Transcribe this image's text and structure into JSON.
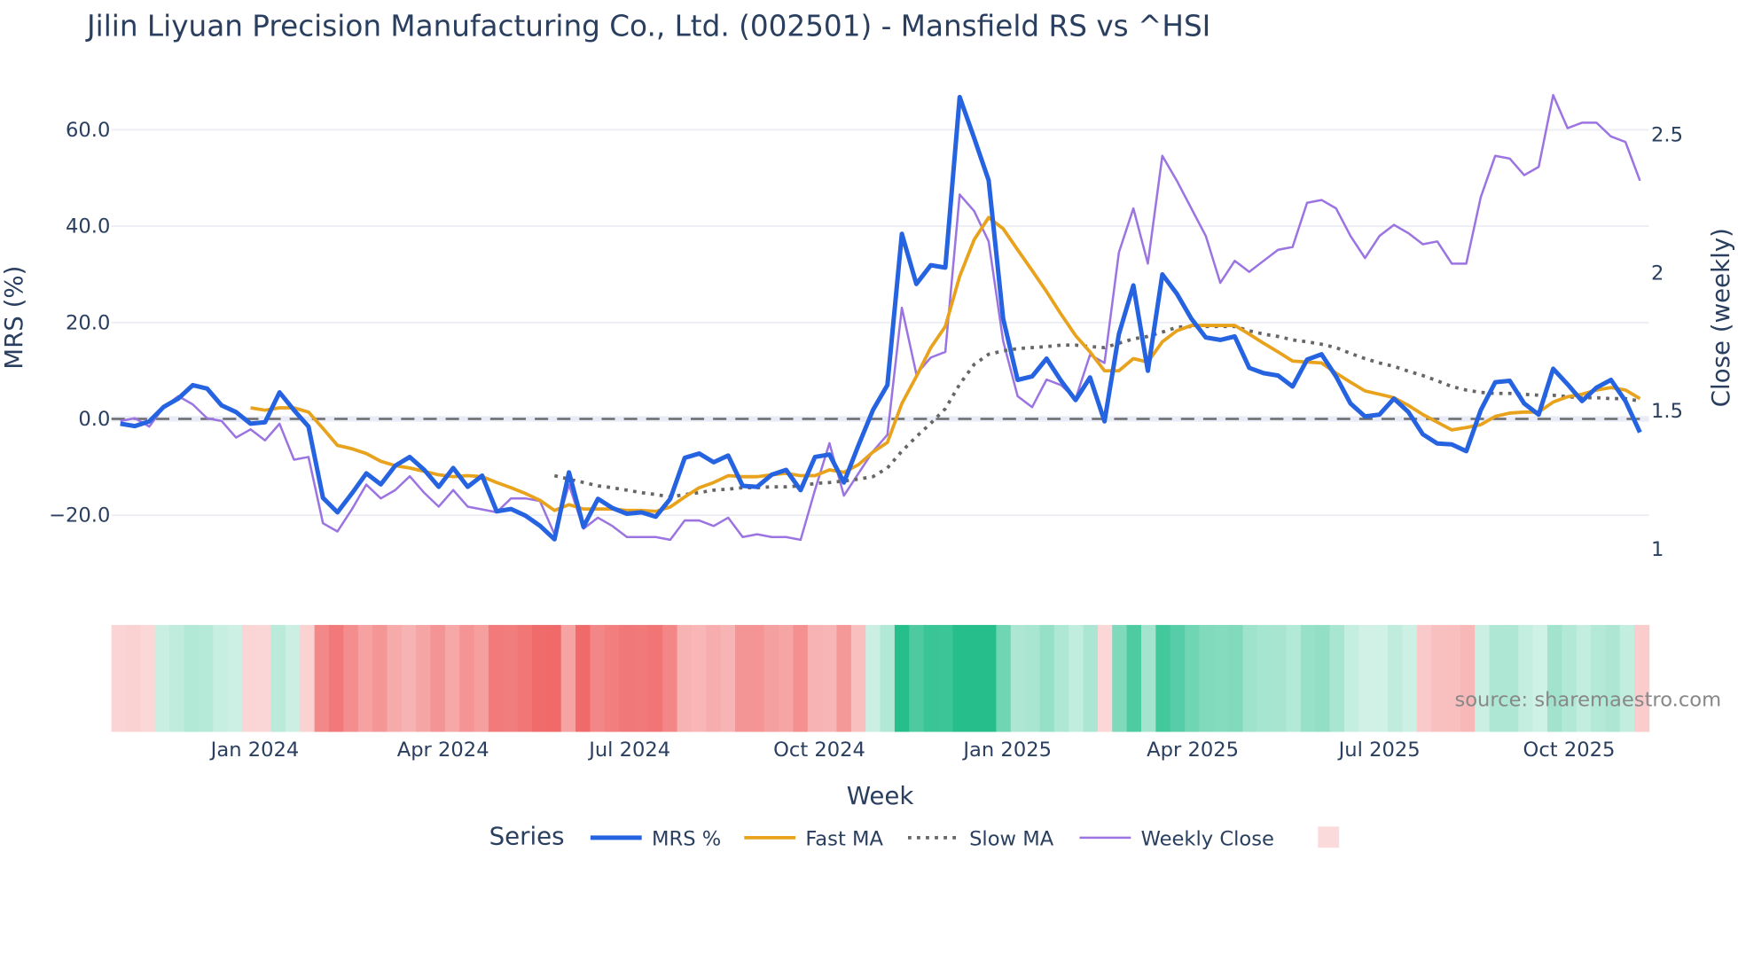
{
  "chart_data": {
    "type": "line",
    "title": "Jilin Liyuan Precision Manufacturing Co., Ltd. (002501) - Mansfield RS vs ^HSI",
    "xlabel": "Week",
    "ylabel": "MRS (%)",
    "y2label": "Close (weekly)",
    "ylim": [
      -27,
      72
    ],
    "y2lim": [
      0.92,
      2.75
    ],
    "yticks": [
      -20,
      0,
      20,
      40,
      60
    ],
    "ytick_labels": [
      "−20.0",
      "0.0",
      "20.0",
      "40.0",
      "60.0"
    ],
    "y2ticks": [
      1,
      1.5,
      2,
      2.5
    ],
    "y2tick_labels": [
      "1",
      "1.5",
      "2",
      "2.5"
    ],
    "x_ticks": [
      {
        "label": "Jan 2024",
        "week": 9.3
      },
      {
        "label": "Apr 2024",
        "week": 22.3
      },
      {
        "label": "Jul 2024",
        "week": 35.2
      },
      {
        "label": "Oct 2024",
        "week": 48.3
      },
      {
        "label": "Jan 2025",
        "week": 61.3
      },
      {
        "label": "Apr 2025",
        "week": 74.1
      },
      {
        "label": "Jul 2025",
        "week": 87.0
      },
      {
        "label": "Oct 2025",
        "week": 100.1
      }
    ],
    "grid": true,
    "legend_title": "Series",
    "legend_position": "bottom",
    "source": "source: sharemaestro.com",
    "series": [
      {
        "name": "MRS %",
        "color": "#2563e0",
        "axis": "y",
        "style": "solid",
        "values": [
          -1,
          -1.5,
          -0.5,
          2.5,
          4.2,
          7,
          6.3,
          2.8,
          1.4,
          -1,
          -0.7,
          5.5,
          1.8,
          -1.6,
          -16.4,
          -19.4,
          -15.5,
          -11.3,
          -13.6,
          -9.7,
          -7.9,
          -10.6,
          -14.1,
          -10.2,
          -14.1,
          -11.8,
          -19.2,
          -18.7,
          -20.1,
          -22.2,
          -25,
          -11.1,
          -22.4,
          -16.6,
          -18.5,
          -19.7,
          -19.4,
          -20.3,
          -16.6,
          -8.1,
          -7.2,
          -9,
          -7.6,
          -13.9,
          -14.1,
          -11.6,
          -10.6,
          -14.8,
          -7.9,
          -7.4,
          -13.2,
          -5.5,
          1.8,
          7,
          38.4,
          28,
          31.9,
          31.4,
          66.8,
          58.3,
          49.5,
          20.8,
          8.1,
          8.8,
          12.5,
          7.9,
          3.9,
          8.6,
          -0.5,
          17.6,
          27.7,
          10,
          30,
          26,
          20.8,
          16.9,
          16.4,
          17.1,
          10.6,
          9.5,
          9,
          6.7,
          12.3,
          13.4,
          8.8,
          3.2,
          0.5,
          0.9,
          4.2,
          1.4,
          -3.2,
          -5.1,
          -5.3,
          -6.7,
          1.8,
          7.6,
          7.9,
          3.2,
          0.9,
          10.4,
          7.2,
          3.7,
          6.5,
          8.1,
          3.7,
          -2.8
        ]
      },
      {
        "name": "Fast MA",
        "color": "#e8a21c",
        "axis": "y",
        "style": "solid",
        "values": [
          2.3,
          1.8,
          2.3,
          2.3,
          1.4,
          -2,
          -5.5,
          -6.2,
          -7.2,
          -8.8,
          -9.7,
          -10.2,
          -10.9,
          -11.6,
          -12,
          -11.8,
          -12,
          -13.2,
          -14.3,
          -15.5,
          -16.9,
          -19,
          -17.8,
          -18.7,
          -18.7,
          -18.7,
          -19,
          -19,
          -19.2,
          -18.3,
          -16.2,
          -14.3,
          -13.2,
          -11.8,
          -12,
          -12,
          -11.6,
          -11.3,
          -11.8,
          -11.8,
          -10.6,
          -11.1,
          -9.5,
          -6.9,
          -4.9,
          3.2,
          8.8,
          14.8,
          19.2,
          29.6,
          37.2,
          41.8,
          39.5,
          35.1,
          30.8,
          26.4,
          21.7,
          17.3,
          13.9,
          10,
          10,
          12.5,
          11.8,
          16,
          18.3,
          19.4,
          19.4,
          19.4,
          19.4,
          17.6,
          15.7,
          13.9,
          12,
          11.8,
          11.6,
          9.5,
          7.6,
          5.8,
          5.1,
          4.4,
          2.8,
          0.9,
          -0.7,
          -2.3,
          -1.8,
          -1.2,
          0.5,
          1.2,
          1.4,
          1.4,
          3.5,
          4.6,
          5.1,
          6,
          6.5,
          6,
          4.2
        ]
      },
      {
        "name": "Slow MA",
        "color": "#666666",
        "axis": "y",
        "style": "dot",
        "values": [
          -11.8,
          -12.5,
          -13.2,
          -13.9,
          -14.3,
          -14.8,
          -15.3,
          -15.7,
          -16.2,
          -15.7,
          -15.3,
          -14.8,
          -14.6,
          -14.3,
          -14.3,
          -14.1,
          -14.1,
          -13.9,
          -13.4,
          -13.2,
          -12.9,
          -12.5,
          -12,
          -10.2,
          -6.7,
          -3.7,
          -0.9,
          2.1,
          7.2,
          11.3,
          13.4,
          14.1,
          14.6,
          14.8,
          15,
          15.3,
          15.3,
          15,
          14.8,
          15.7,
          16.6,
          17.1,
          18,
          19,
          19.2,
          19.2,
          19.2,
          19.2,
          18.3,
          17.6,
          17.1,
          16.4,
          16,
          15.5,
          14.8,
          13.6,
          12.5,
          11.6,
          10.9,
          9.9,
          9,
          7.9,
          6.7,
          6,
          5.5,
          5.3,
          5.3,
          5.1,
          4.9,
          4.9,
          4.6,
          4.4,
          4.4,
          4.2,
          4.2,
          3.7
        ]
      },
      {
        "name": "Weekly Close",
        "color": "#9b74e2",
        "axis": "y2",
        "style": "solid",
        "values": [
          1.46,
          1.47,
          1.44,
          1.51,
          1.55,
          1.52,
          1.47,
          1.46,
          1.4,
          1.43,
          1.39,
          1.45,
          1.32,
          1.33,
          1.09,
          1.06,
          1.14,
          1.23,
          1.18,
          1.21,
          1.26,
          1.2,
          1.15,
          1.21,
          1.15,
          1.14,
          1.13,
          1.18,
          1.18,
          1.17,
          1.05,
          1.23,
          1.07,
          1.11,
          1.08,
          1.04,
          1.04,
          1.04,
          1.03,
          1.1,
          1.1,
          1.08,
          1.11,
          1.04,
          1.05,
          1.04,
          1.04,
          1.03,
          1.21,
          1.38,
          1.19,
          1.27,
          1.35,
          1.41,
          1.87,
          1.63,
          1.69,
          1.71,
          2.28,
          2.22,
          2.11,
          1.75,
          1.55,
          1.51,
          1.61,
          1.59,
          1.54,
          1.7,
          1.67,
          2.07,
          2.23,
          2.03,
          2.42,
          2.33,
          2.23,
          2.13,
          1.96,
          2.04,
          2.0,
          2.04,
          2.08,
          2.09,
          2.25,
          2.26,
          2.23,
          2.13,
          2.05,
          2.13,
          2.17,
          2.14,
          2.1,
          2.11,
          2.03,
          2.03,
          2.27,
          2.42,
          2.41,
          2.35,
          2.38,
          2.64,
          2.52,
          2.54,
          2.54,
          2.49,
          2.47,
          2.33
        ]
      }
    ],
    "heatmap_legend_color": "#fadadb"
  }
}
